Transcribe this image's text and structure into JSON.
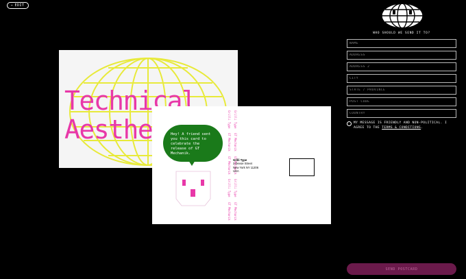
{
  "edit_button": {
    "icon": "back-arrow-icon",
    "label": "EDIT"
  },
  "front_card": {
    "line1": "Technical",
    "line2": "Aesthet"
  },
  "back_card": {
    "message": "Hey! A friend sent you this card to celebrate the release of GT Mechanik.",
    "stamp_col_1": [
      "Grilli Type",
      "GT Mechanik",
      "GT Mechanik",
      "Grilli Type",
      "GT Mechanik"
    ],
    "stamp_col_2": [
      "Grilli Type",
      "GT Mechanik",
      "GT Mechanik",
      "Grilli Type",
      "GT Mechanik"
    ],
    "address": [
      "Grilli Type",
      "3 Devoe Street",
      "New York NY 11206",
      "USA"
    ]
  },
  "form": {
    "title": "WHO SHOULD WE SEND IT TO?",
    "fields": [
      {
        "name": "name-field",
        "placeholder": "NAME"
      },
      {
        "name": "address-field",
        "placeholder": "ADDRESS"
      },
      {
        "name": "address-2-field",
        "placeholder": "ADDRESS 2"
      },
      {
        "name": "city-field",
        "placeholder": "CITY"
      },
      {
        "name": "state-field",
        "placeholder": "STATE / PROVINCE"
      },
      {
        "name": "postcode-field",
        "placeholder": "POST CODE"
      },
      {
        "name": "country-field",
        "placeholder": "COUNTRY"
      }
    ],
    "agree_text": "MY MESSAGE IS FRIENDLY AND NON-POLITICAL. I AGREE TO THE",
    "terms_link": "TERMS & CONDITIONS",
    "agree_suffix": ".",
    "send_label": "SEND POSTCARD"
  },
  "colors": {
    "background": "#000000",
    "accent_pink": "#e838a8",
    "bubble_green": "#1a7a1a",
    "globe_yellow": "#e8ea3a",
    "send_button": "#6b1a4b"
  }
}
